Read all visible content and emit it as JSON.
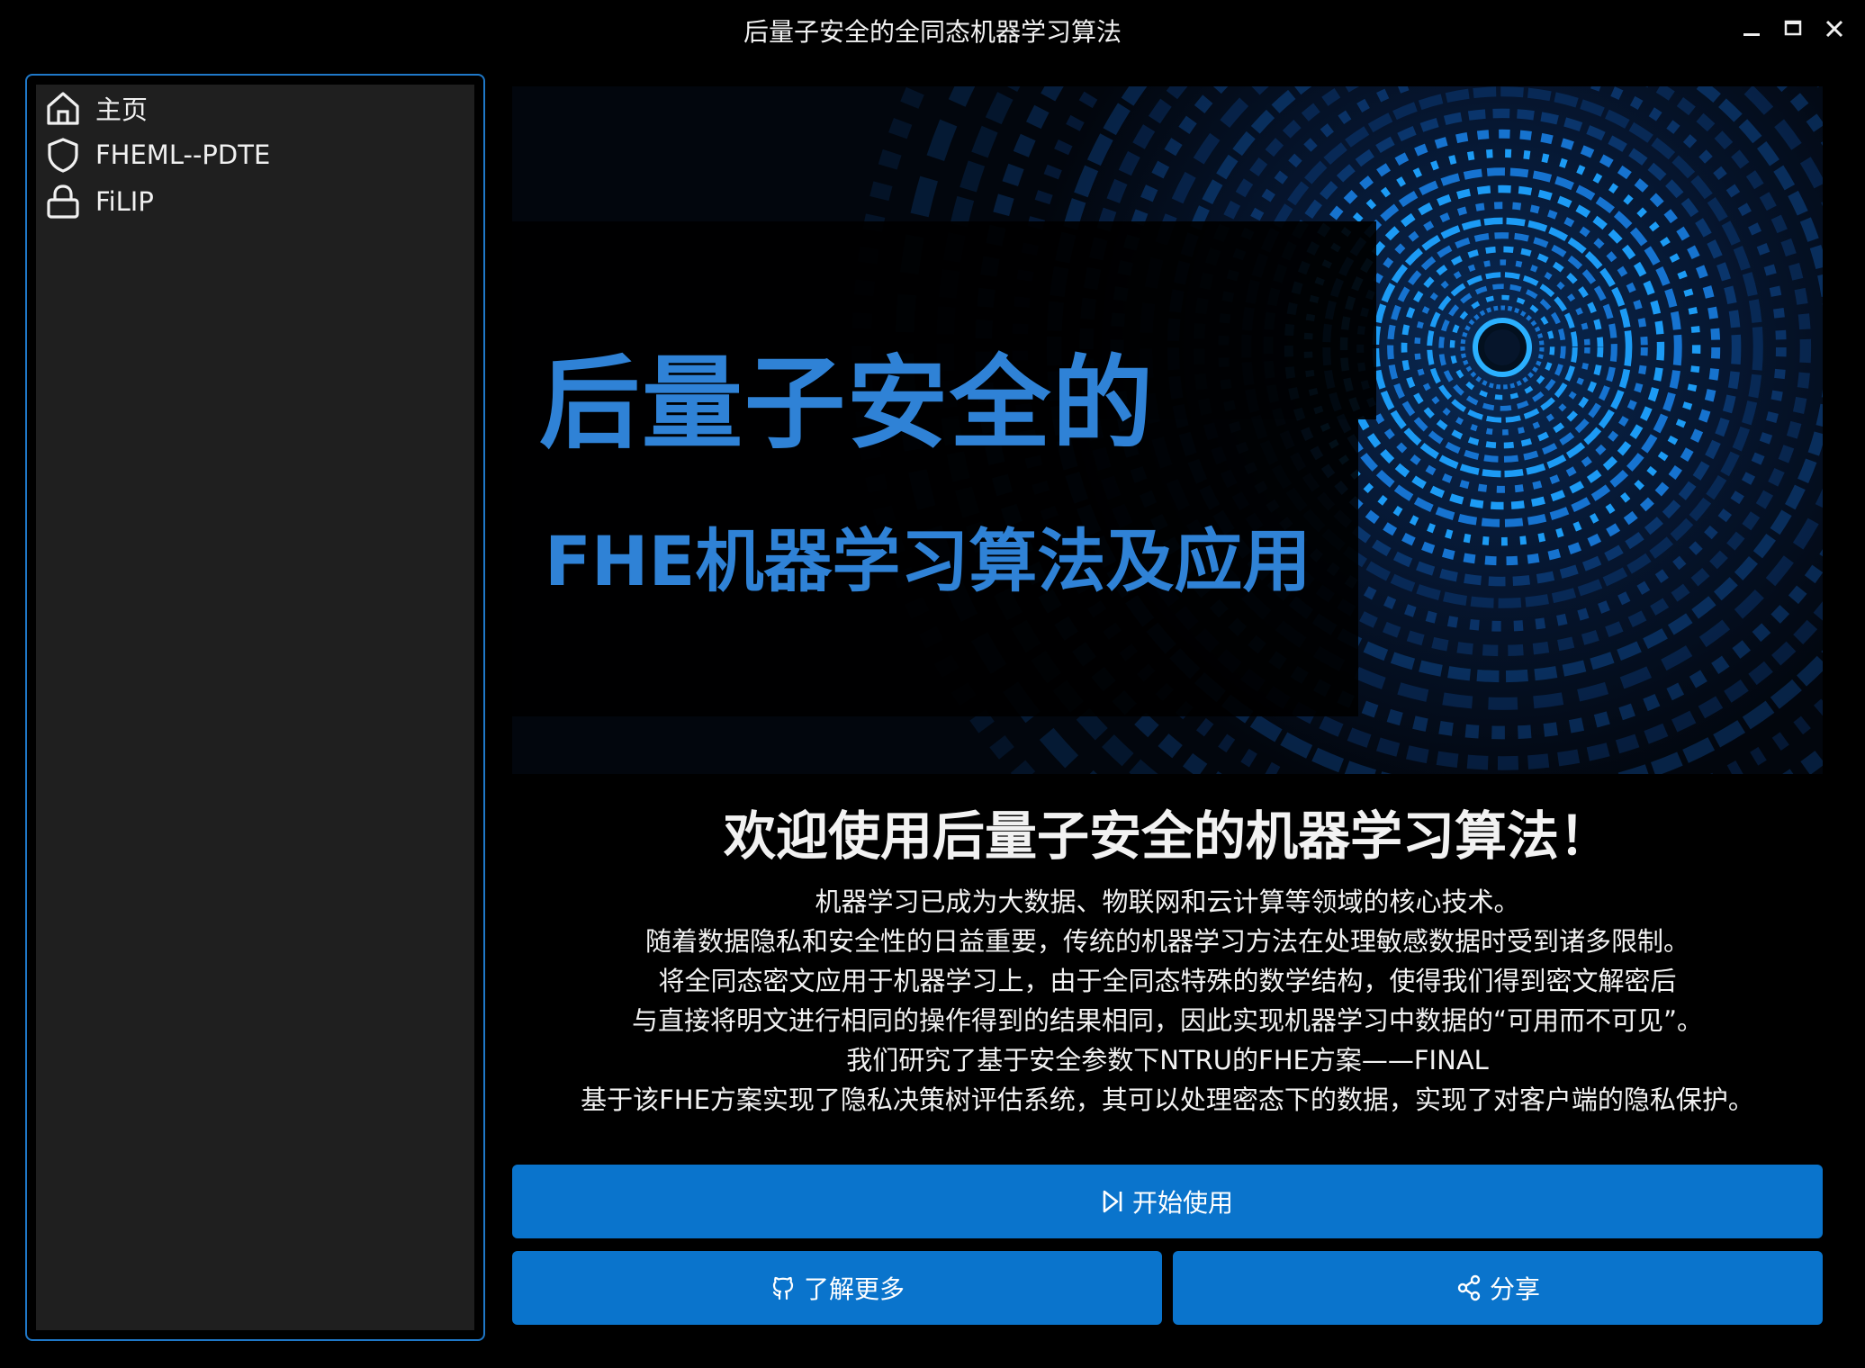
{
  "window": {
    "title": "后量子安全的全同态机器学习算法",
    "controls": [
      "minimize-icon",
      "maximize-icon",
      "close-icon"
    ]
  },
  "sidebar": {
    "items": [
      {
        "label": "主页",
        "icon": "home-icon"
      },
      {
        "label": "FHEML--PDTE",
        "icon": "shield-icon"
      },
      {
        "label": "FiLIP",
        "icon": "lock-icon"
      }
    ]
  },
  "banner": {
    "title_line1": "后量子安全的",
    "title_line2": "FHE机器学习算法及应用"
  },
  "main": {
    "welcome": "欢迎使用后量子安全的机器学习算法！",
    "description": [
      "机器学习已成为大数据、物联网和云计算等领域的核心技术。",
      "随着数据隐私和安全性的日益重要，传统的机器学习方法在处理敏感数据时受到诸多限制。",
      "将全同态密文应用于机器学习上，由于全同态特殊的数学结构，使得我们得到密文解密后",
      "与直接将明文进行相同的操作得到的结果相同，因此实现机器学习中数据的“可用而不可见”。",
      "我们研究了基于安全参数下NTRU的FHE方案——FINAL",
      "基于该FHE方案实现了隐私决策树评估系统，其可以处理密态下的数据，实现了对客户端的隐私保护。"
    ]
  },
  "buttons": {
    "start": {
      "label": "开始使用",
      "icon": "play-icon"
    },
    "learn_more": {
      "label": "了解更多",
      "icon": "github-icon"
    },
    "share": {
      "label": "分享",
      "icon": "share-icon"
    }
  },
  "colors": {
    "accent": "#0a74cc",
    "sidebar_border": "#1f78c8",
    "banner_text": "#2f82d6"
  }
}
